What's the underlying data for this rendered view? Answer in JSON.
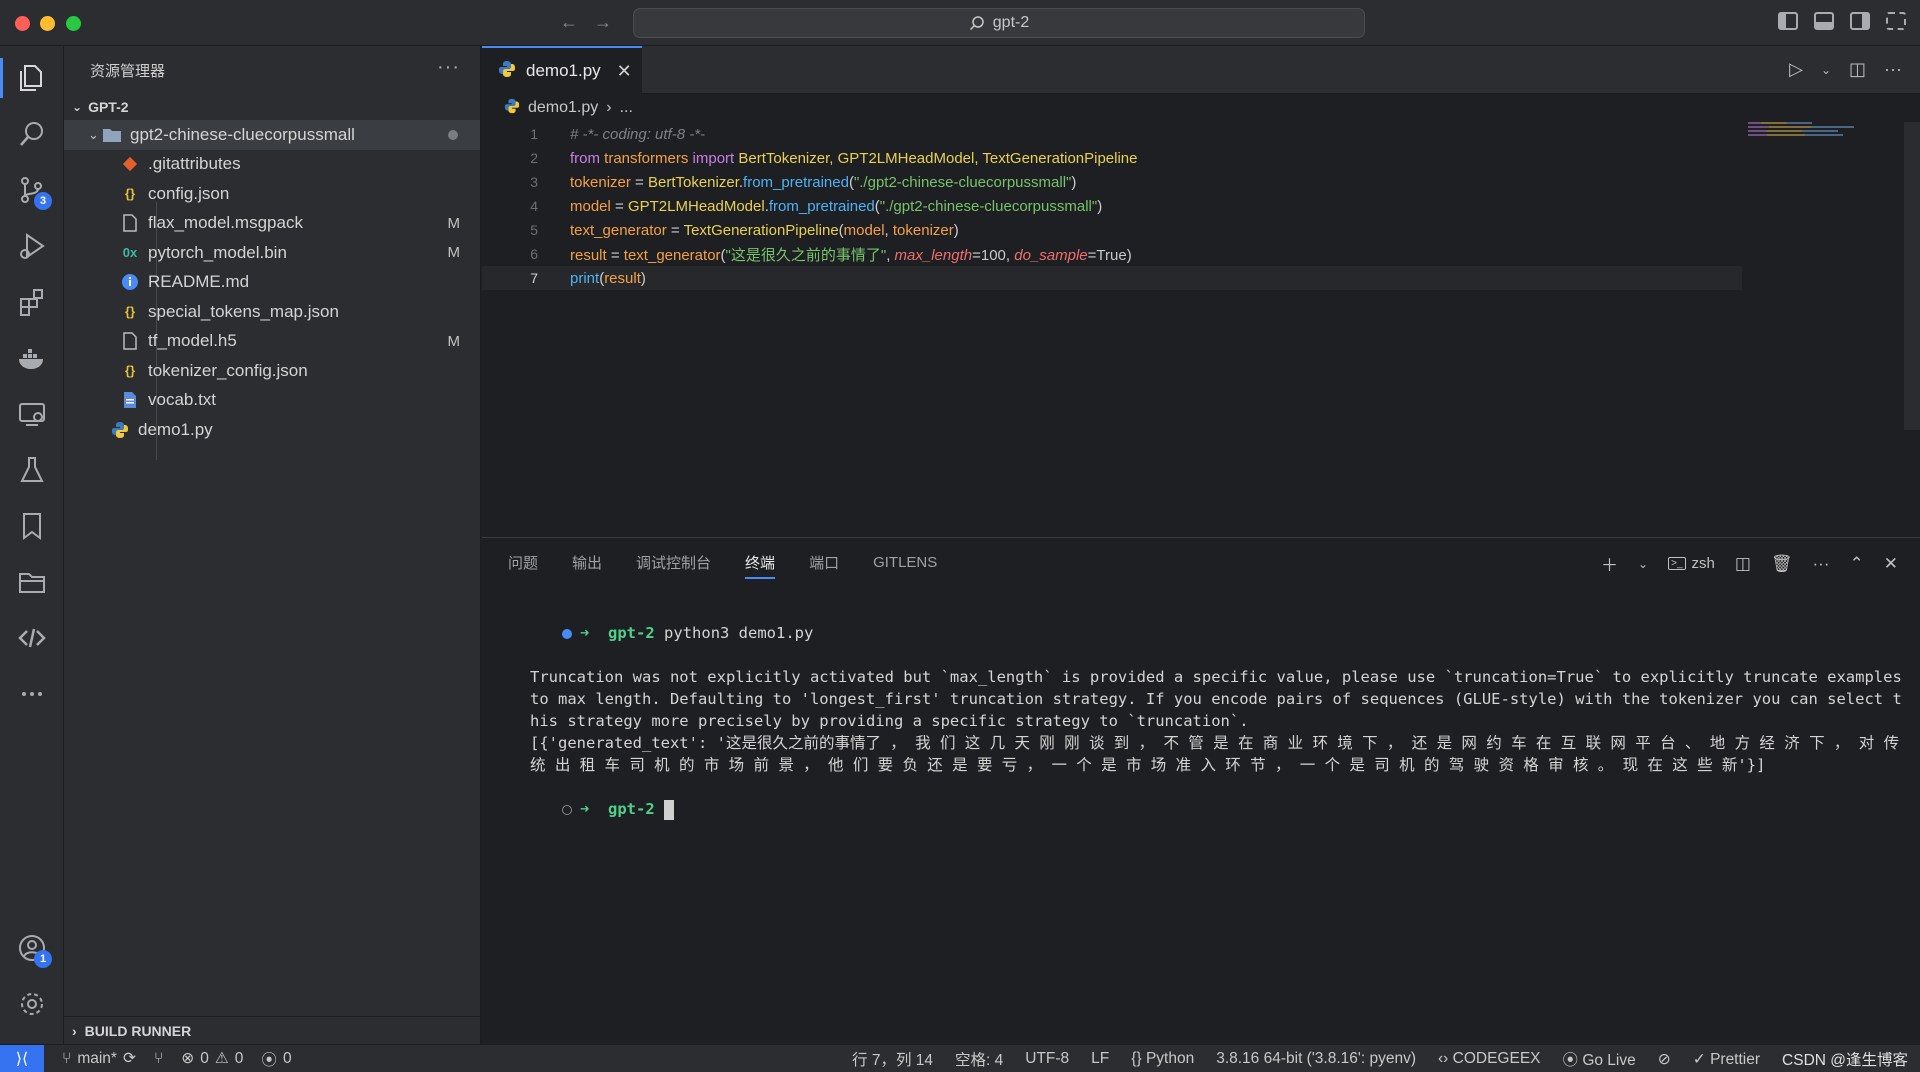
{
  "window": {
    "search_text": "gpt-2"
  },
  "activity_badges": {
    "source_control": "3",
    "accounts": "1"
  },
  "sidebar": {
    "title": "资源管理器",
    "section": "GPT-2",
    "folder": "gpt2-chinese-cluecorpussmall",
    "files": [
      {
        "name": ".gitattributes",
        "icon": "git-icon",
        "mark": ""
      },
      {
        "name": "config.json",
        "icon": "json-icon",
        "mark": ""
      },
      {
        "name": "flax_model.msgpack",
        "icon": "file-icon",
        "mark": "M"
      },
      {
        "name": "pytorch_model.bin",
        "icon": "binary-icon",
        "mark": "M"
      },
      {
        "name": "README.md",
        "icon": "info-icon",
        "mark": ""
      },
      {
        "name": "special_tokens_map.json",
        "icon": "json-icon",
        "mark": ""
      },
      {
        "name": "tf_model.h5",
        "icon": "file-icon",
        "mark": "M"
      },
      {
        "name": "tokenizer_config.json",
        "icon": "json-icon",
        "mark": ""
      },
      {
        "name": "vocab.txt",
        "icon": "text-file-icon",
        "mark": ""
      }
    ],
    "root_file": "demo1.py",
    "build_runner": "BUILD RUNNER"
  },
  "editor": {
    "tab_label": "demo1.py",
    "breadcrumb_file": "demo1.py",
    "breadcrumb_rest": "...",
    "line_numbers": [
      "1",
      "2",
      "3",
      "4",
      "5",
      "6",
      "7"
    ],
    "code": {
      "l1": "# -*- coding: utf-8 -*-",
      "l2_kw1": "from",
      "l2_mod": "transformers",
      "l2_kw2": "import",
      "l2_names": "BertTokenizer, GPT2LMHeadModel, TextGenerationPipeline",
      "l3_var": "tokenizer",
      "l3_cls": "BertTokenizer",
      "l3_fn": "from_pretrained",
      "l3_str": "\"./gpt2-chinese-cluecorpussmall\"",
      "l4_var": "model",
      "l4_cls": "GPT2LMHeadModel",
      "l4_fn": "from_pretrained",
      "l4_str": "\"./gpt2-chinese-cluecorpussmall\"",
      "l5_var": "text_generator",
      "l5_cls": "TextGenerationPipeline",
      "l5_arg1": "model",
      "l5_arg2": "tokenizer",
      "l6_var": "result",
      "l6_fn": "text_generator",
      "l6_str": "\"这是很久之前的事情了\"",
      "l6_p1": "max_length",
      "l6_v1": "100",
      "l6_p2": "do_sample",
      "l6_v2": "True",
      "l7_fn": "print",
      "l7_arg": "result"
    }
  },
  "panel": {
    "tabs": [
      "问题",
      "输出",
      "调试控制台",
      "终端",
      "端口",
      "GITLENS"
    ],
    "active_tab": "终端",
    "shell": "zsh",
    "terminal": {
      "prompt_dir": "gpt-2",
      "command": "python3 demo1.py",
      "warning": "Truncation was not explicitly activated but `max_length` is provided a specific value, please use `truncation=True` to explicitly truncate examples to max length. Defaulting to 'longest_first' truncation strategy. If you encode pairs of sequences (GLUE-style) with the tokenizer you can select this strategy more precisely by providing a specific strategy to `truncation`.",
      "output": "[{'generated_text': '这是很久之前的事情了 ， 我 们 这 几 天 刚 刚 谈 到 ， 不 管 是 在 商 业 环 境 下 ， 还 是 网 约 车 在 互 联 网 平 台 、 地 方 经 济 下 ， 对 传 统 出 租 车 司 机 的 市 场 前 景 ， 他 们 要 负 还 是 要 亏 ， 一 个 是 市 场 准 入 环 节 ， 一 个 是 司 机 的 驾 驶 资 格 审 核 。 现 在 这 些 新'}]",
      "prompt2_dir": "gpt-2"
    }
  },
  "statusbar": {
    "branch": "main*",
    "errors": "0",
    "warnings": "0",
    "ports": "0",
    "position": "行 7，列 14",
    "spaces": "空格: 4",
    "encoding": "UTF-8",
    "eol": "LF",
    "language": "Python",
    "interpreter": "3.8.16 64-bit ('3.8.16': pyenv)",
    "codegeex": "CODEGEEX",
    "golive": "Go Live",
    "prettier": "Prettier",
    "watermark": "CSDN @逢生博客"
  },
  "colors": {
    "accent": "#3573f0",
    "background": "#1e1f22",
    "chrome": "#2b2d30"
  }
}
